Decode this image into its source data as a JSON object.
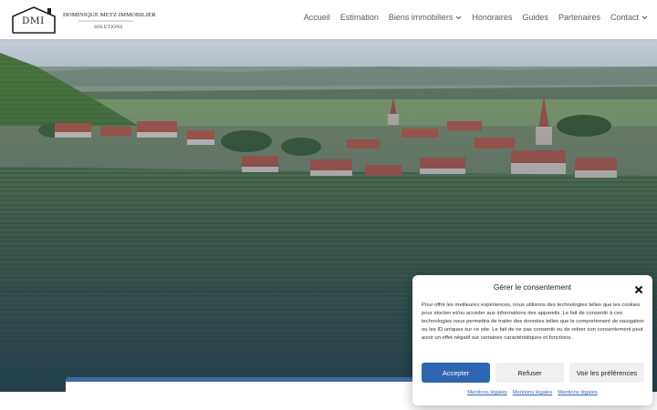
{
  "logo": {
    "abbr": "DMI",
    "name": "DOMINIQUE METZ IMMOBILIER",
    "tagline": "SOLUTIONS"
  },
  "nav": {
    "items": [
      {
        "label": "Accueil"
      },
      {
        "label": "Estimation"
      },
      {
        "label": "Biens immobiliers"
      },
      {
        "label": "Honoraires"
      },
      {
        "label": "Guides"
      },
      {
        "label": "Partenaires"
      },
      {
        "label": "Contact"
      }
    ]
  },
  "colors": {
    "accent": "#2f66b2",
    "card_border": "#3e6aa8",
    "nav_text": "#5a5a5a"
  },
  "cookie": {
    "title": "Gérer le consentement",
    "body": "Pour offrir les meilleures expériences, nous utilisons des technologies telles que les cookies pour stocker et/ou accéder aux informations des appareils. Le fait de consentir à ces technologies nous permettra de traiter des données telles que le comportement de navigation ou les ID uniques sur ce site. Le fait de ne pas consentir ou de retirer son consentement peut avoir un effet négatif sur certaines caractéristiques et fonctions.",
    "accept_label": "Accepter",
    "refuse_label": "Refuser",
    "prefs_label": "Voir les préférences",
    "links": [
      "Mentions légales",
      "Mentions légales",
      "Mentions légales"
    ]
  }
}
